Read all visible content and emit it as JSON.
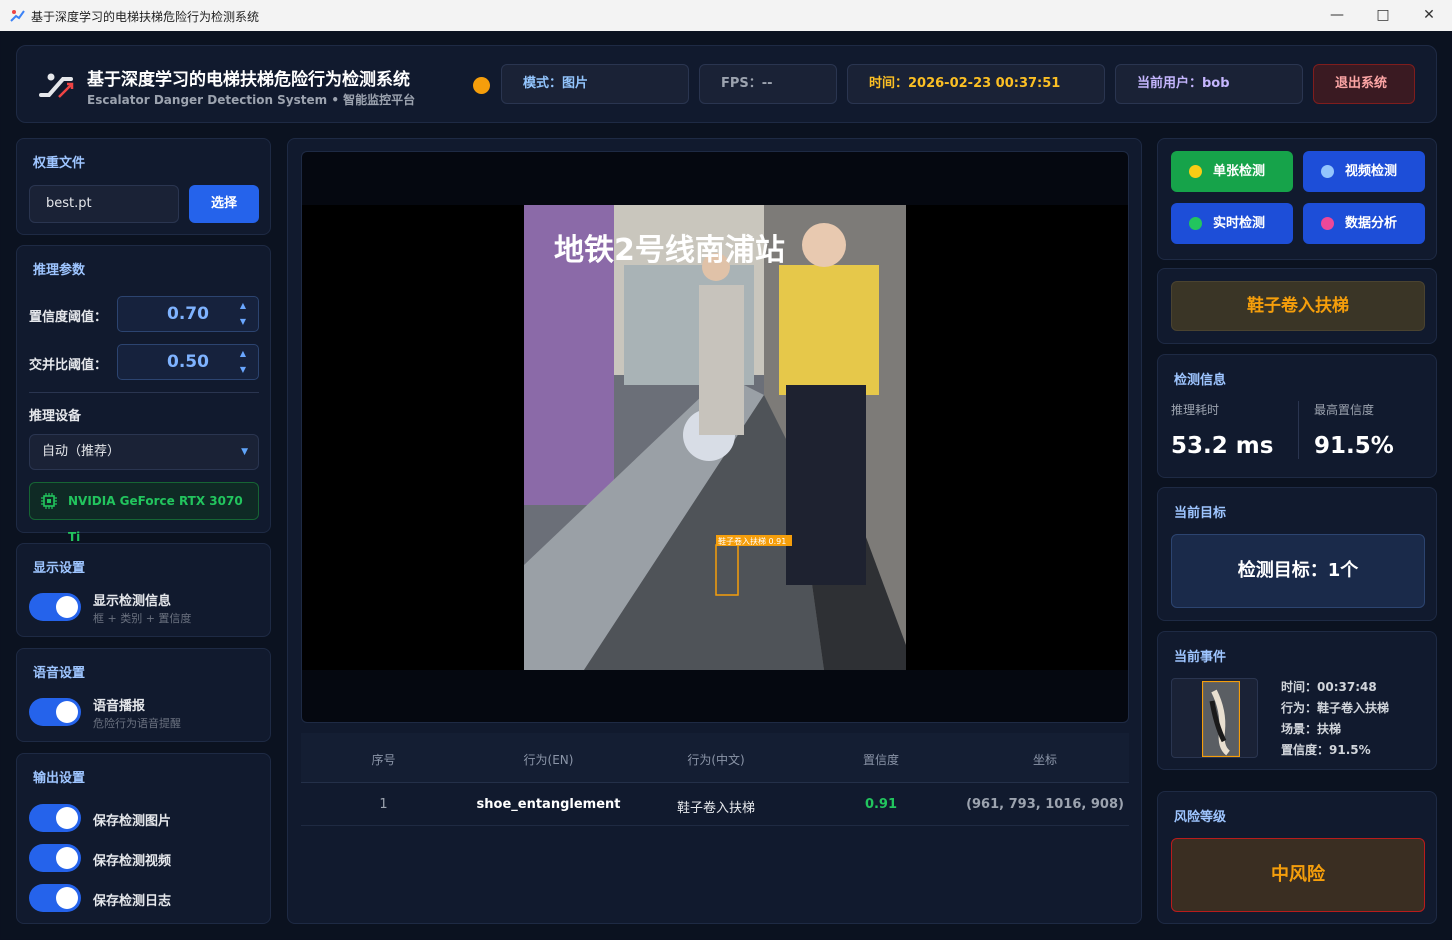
{
  "window": {
    "title": "基于深度学习的电梯扶梯危险行为检测系统"
  },
  "header": {
    "title": "基于深度学习的电梯扶梯危险行为检测系统",
    "subtitle": "Escalator Danger Detection System • 智能监控平台",
    "mode": "模式：图片",
    "fps": "FPS：--",
    "time": "时间：2026-02-23 00:37:51",
    "user": "当前用户：bob",
    "logout": "退出系统",
    "status_color": "#f59e0b"
  },
  "left": {
    "weights": {
      "title": "权重文件",
      "file": "best.pt",
      "select": "选择"
    },
    "infer": {
      "title": "推理参数",
      "conf_label": "置信度阈值：",
      "conf_value": "0.70",
      "iou_label": "交并比阈值：",
      "iou_value": "0.50",
      "device_title": "推理设备",
      "device_value": "自动（推荐）",
      "gpu": "NVIDIA GeForce RTX 3070 Ti"
    },
    "display": {
      "title": "显示设置",
      "toggle_label": "显示检测信息",
      "toggle_sub": "框 + 类别 + 置信度"
    },
    "voice": {
      "title": "语音设置",
      "toggle_label": "语音播报",
      "toggle_sub": "危险行为语音提醒"
    },
    "output": {
      "title": "输出设置",
      "save_image": "保存检测图片",
      "save_video": "保存检测视频",
      "save_log": "保存检测日志"
    }
  },
  "center": {
    "image_caption": "地铁2号线南浦站",
    "box_label": "鞋子卷入扶梯 0.91",
    "table": {
      "headers": [
        "序号",
        "行为(EN)",
        "行为(中文)",
        "置信度",
        "坐标"
      ],
      "rows": [
        [
          "1",
          "shoe_entanglement",
          "鞋子卷入扶梯",
          "0.91",
          "(961, 793, 1016, 908)"
        ]
      ]
    }
  },
  "right": {
    "buttons": [
      {
        "label": "单张检测",
        "color": "#16a34a",
        "dot": "#facc15"
      },
      {
        "label": "视频检测",
        "color": "#1d4ed8",
        "dot": "#93c5fd"
      },
      {
        "label": "实时检测",
        "color": "#1d4ed8",
        "dot": "#22c55e"
      },
      {
        "label": "数据分析",
        "color": "#1d4ed8",
        "dot": "#ec4899"
      }
    ],
    "alert": "鞋子卷入扶梯",
    "info": {
      "title": "检测信息",
      "time_label": "推理耗时",
      "time_value": "53.2 ms",
      "conf_label": "最高置信度",
      "conf_value": "91.5%"
    },
    "target": {
      "title": "当前目标",
      "value": "检测目标：1个"
    },
    "event": {
      "title": "当前事件",
      "time": "时间：00:37:48",
      "action": "行为：鞋子卷入扶梯",
      "scene": "场景：扶梯",
      "conf": "置信度：91.5%"
    },
    "risk": {
      "title": "风险等级",
      "value": "中风险"
    }
  }
}
